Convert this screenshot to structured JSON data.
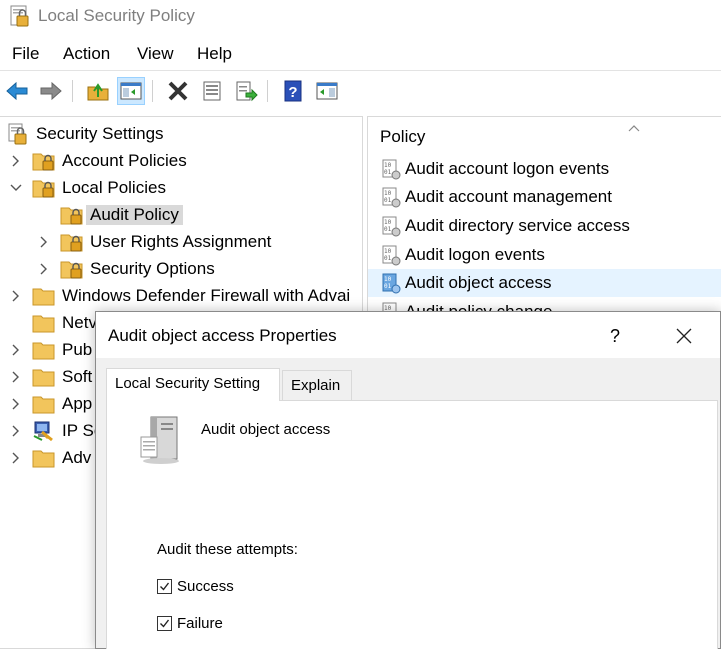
{
  "window": {
    "title": "Local Security Policy"
  },
  "menu": {
    "file": "File",
    "action": "Action",
    "view": "View",
    "help": "Help"
  },
  "tree": {
    "root": "Security Settings",
    "account_policies": "Account Policies",
    "local_policies": "Local Policies",
    "audit_policy": "Audit Policy",
    "user_rights": "User Rights Assignment",
    "security_options": "Security Options",
    "firewall": "Windows Defender Firewall with Advai",
    "net": "Netv",
    "pub": "Pub",
    "soft": "Soft",
    "app": "App",
    "ip": "IP Se",
    "adv": "Adv"
  },
  "list": {
    "header": "Policy",
    "items": [
      "Audit account logon events",
      "Audit account management",
      "Audit directory service access",
      "Audit logon events",
      "Audit object access",
      "Audit policy change"
    ],
    "selected_index": 4
  },
  "dialog": {
    "title": "Audit object access Properties",
    "help": "?",
    "tabs": [
      "Local Security Setting",
      "Explain"
    ],
    "policy_name": "Audit object access",
    "attempts_label": "Audit these attempts:",
    "success_label": "Success",
    "success_checked": true,
    "failure_label": "Failure",
    "failure_checked": true
  },
  "colors": {
    "selection": "#e5f3ff",
    "tree_selected": "#d9d9d9",
    "dialog_bg": "#f0f0f0"
  }
}
